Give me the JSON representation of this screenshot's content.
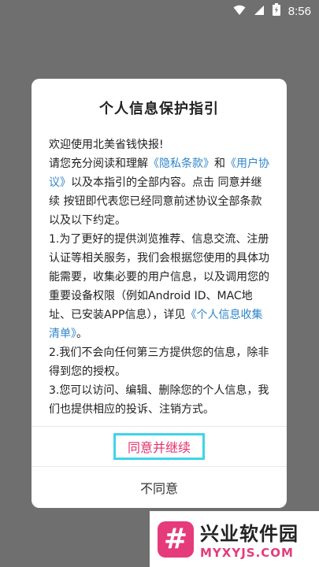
{
  "status": {
    "time": "8:56"
  },
  "dialog": {
    "title": "个人信息保护指引",
    "greeting": "欢迎使用北美省钱快报!",
    "p1_pre": "请您充分阅读和理解",
    "privacy_link": "《隐私条款》",
    "and": "和",
    "user_agreement_link": "《用户协议》",
    "p1_post": "以及本指引的全部内容。点击 同意并继续 按钮即代表您已经同意前述协议全部条款以及以下约定。",
    "item1_pre": "1.为了更好的提供浏览推荐、信息交流、注册认证等相关服务，我们会根据您使用的具体功能需要，收集必要的用户信息，以及调用您的重要设备权限（例如Android ID、MAC地址、已安装APP信息），详见",
    "info_list_link": "《个人信息收集清单》",
    "item1_end": "。",
    "item2": "2.我们不会向任何第三方提供您的信息，除非得到您的授权。",
    "item3": "3.您可以访问、编辑、删除您的个人信息，我们也提供相应的投诉、注销方式。",
    "agree_label": "同意并继续",
    "disagree_label": "不同意"
  },
  "watermark": {
    "logo": "#",
    "name_cn": "兴业软件园",
    "name_en": "MYXYJS.COM"
  },
  "colors": {
    "link": "#2f86c9",
    "agree_text": "#e2316d",
    "agree_border": "#3fd4e8"
  }
}
